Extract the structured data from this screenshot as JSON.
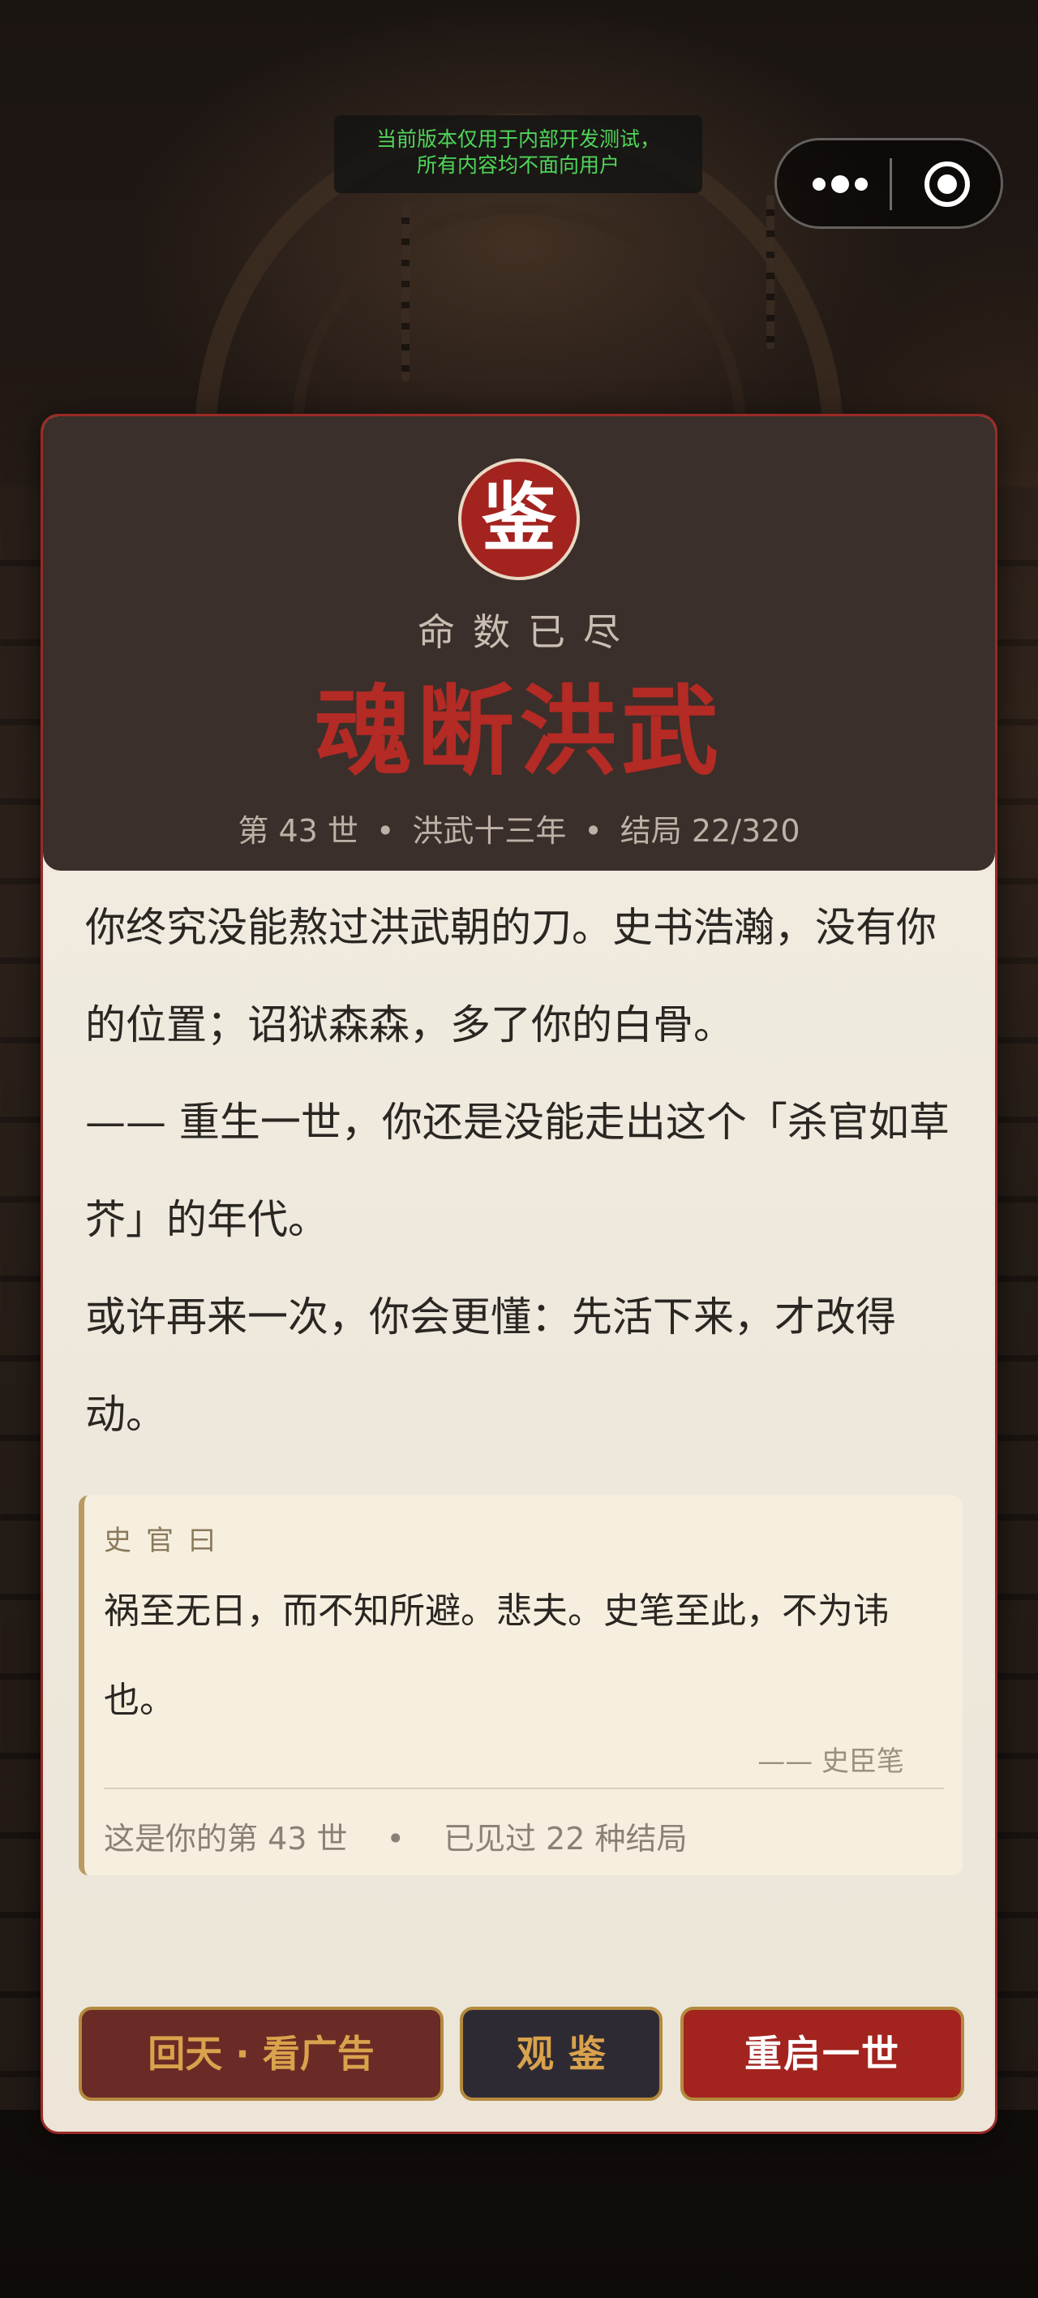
{
  "dev_notice": {
    "line1": "当前版本仅用于内部开发测试，",
    "line2": "所有内容均不面向用户"
  },
  "capsule": {
    "more_icon": "more-dots-icon",
    "close_icon": "target-close-icon"
  },
  "header": {
    "seal": "鉴",
    "subtitle": "命数已尽",
    "title": "魂断洪武",
    "meta": {
      "life": "第 43 世",
      "era": "洪武十三年",
      "ending": "结局 22/320",
      "separator": "•"
    }
  },
  "body": {
    "paragraphs": [
      "你终究没能熬过洪武朝的刀。史书浩瀚，没有你的位置；诏狱森森，多了你的白骨。",
      "—— 重生一世，你还是没能走出这个「杀官如草芥」的年代。",
      "或许再来一次，你会更懂：先活下来，才改得动。"
    ]
  },
  "historian": {
    "label": "史官曰",
    "quote": "祸至无日，而不知所避。悲夫。史笔至此，不为讳也。",
    "signature": "—— 史臣笔",
    "stats_life": "这是你的第 43 世",
    "stats_sep": "•",
    "stats_endings": "已见过 22 种结局"
  },
  "buttons": {
    "revive": "回天 · 看广告",
    "view": "观鉴",
    "restart": "重启一世"
  },
  "colors": {
    "accent_red": "#a3231f",
    "title_red": "#b42a24",
    "gold": "#d9a24c",
    "header_bg": "#3a2f2a",
    "paper_bg": "#f1ece2"
  }
}
